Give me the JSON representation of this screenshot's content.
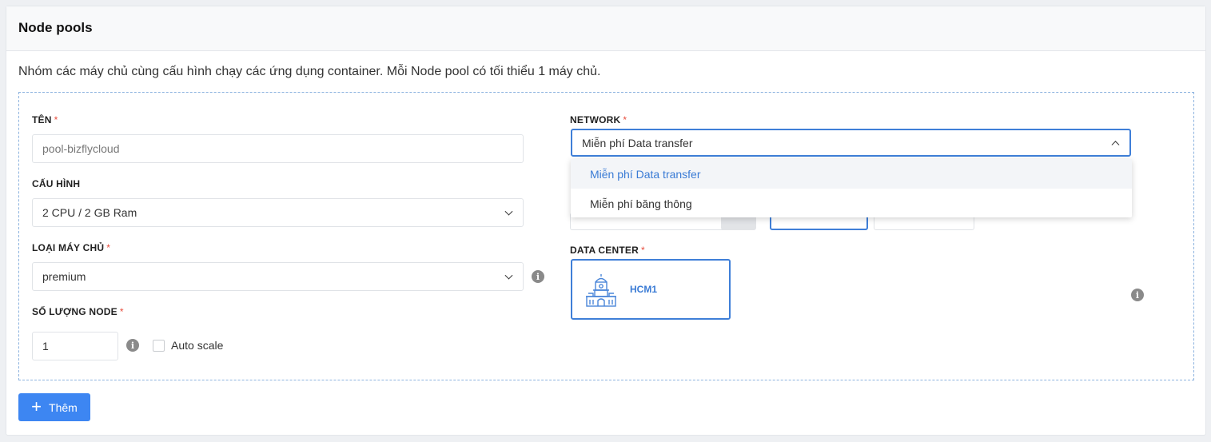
{
  "header": {
    "title": "Node pools"
  },
  "description": "Nhóm các máy chủ cùng cấu hình chạy các ứng dụng container. Mỗi Node pool có tối thiểu 1 máy chủ.",
  "form": {
    "name": {
      "label": "TÊN",
      "required": "*",
      "placeholder": "pool-bizflycloud"
    },
    "config": {
      "label": "CẤU HÌNH",
      "value": "2 CPU / 2 GB Ram"
    },
    "server_type": {
      "label": "LOẠI MÁY CHỦ",
      "required": "*",
      "value": "premium"
    },
    "node_count": {
      "label": "SỐ LƯỢNG NODE",
      "required": "*",
      "value": "1"
    },
    "auto_scale": {
      "label": "Auto scale",
      "checked": false
    },
    "network": {
      "label": "NETWORK",
      "required": "*",
      "value": "Miễn phí Data transfer",
      "options": [
        "Miễn phí Data transfer",
        "Miễn phí băng thông"
      ],
      "selected_index": 0
    },
    "data_center": {
      "label": "DATA CENTER",
      "required": "*",
      "selected": "HCM1"
    }
  },
  "add_button": {
    "label": "Thêm"
  },
  "colors": {
    "accent": "#3d86f2",
    "required": "#e74c3c",
    "selected_border": "#3f7fd8"
  }
}
